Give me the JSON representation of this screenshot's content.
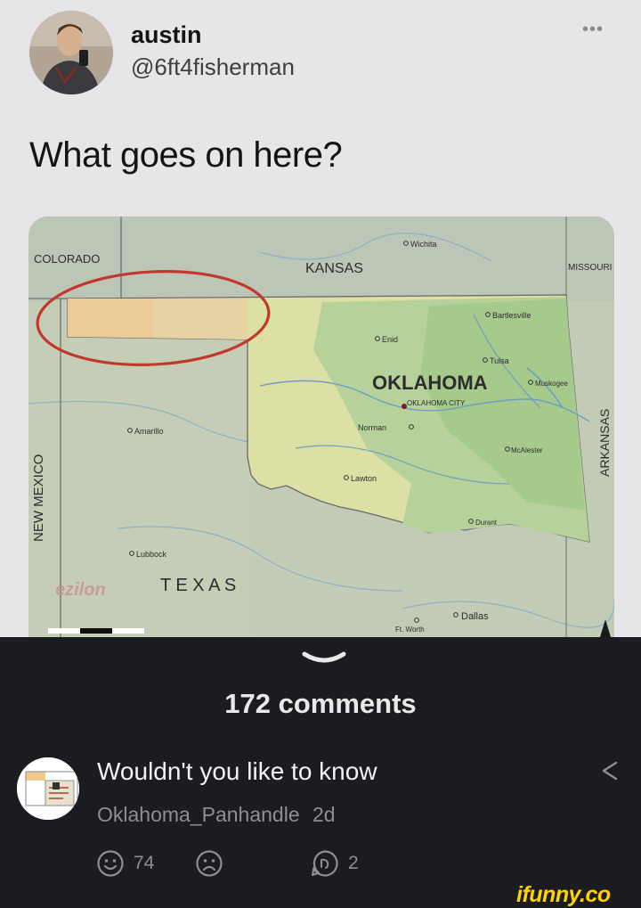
{
  "tweet": {
    "name": "austin",
    "handle": "@6ft4fisherman",
    "more_icon": "more-dots-icon",
    "text": "What goes on here?"
  },
  "map": {
    "labels": {
      "colorado": "COLORADO",
      "kansas": "KANSAS",
      "missouri": "MISSOURI",
      "oklahoma": "OKLAHOMA",
      "new_mexico": "NEW MEXICO",
      "arkansas": "ARKANSAS",
      "texas": "T E X A S"
    },
    "cities": {
      "wichita": "Wichita",
      "bartlesville": "Bartlesville",
      "enid": "Enid",
      "tulsa": "Tulsa",
      "muskogee": "Muskogee",
      "oklahoma_city": "OKLAHOMA CITY",
      "norman": "Norman",
      "mcalester": "McAlester",
      "amarillo": "Amarillo",
      "lawton": "Lawton",
      "durant": "Durant",
      "lubbock": "Lubbock",
      "dallas": "Dallas",
      "fort_worth": "Ft. Worth"
    },
    "watermark": "ezilon",
    "colors": {
      "highlight_circle": "#c0392b",
      "panhandle": "#f0c98c",
      "oklahoma": "#d9dca0"
    }
  },
  "comments": {
    "count_label": "172 comments",
    "items": [
      {
        "text": "Wouldn't you like to know",
        "user": "Oklahoma_Panhandle",
        "time": "2d",
        "smile_count": "74",
        "reply_count": "2"
      }
    ]
  },
  "brand": {
    "logo": "ifunny.co",
    "color": "#ffd200"
  },
  "colors": {
    "background": "#1b1c20",
    "muted": "#8e8e93",
    "text": "#f2f2f2"
  }
}
